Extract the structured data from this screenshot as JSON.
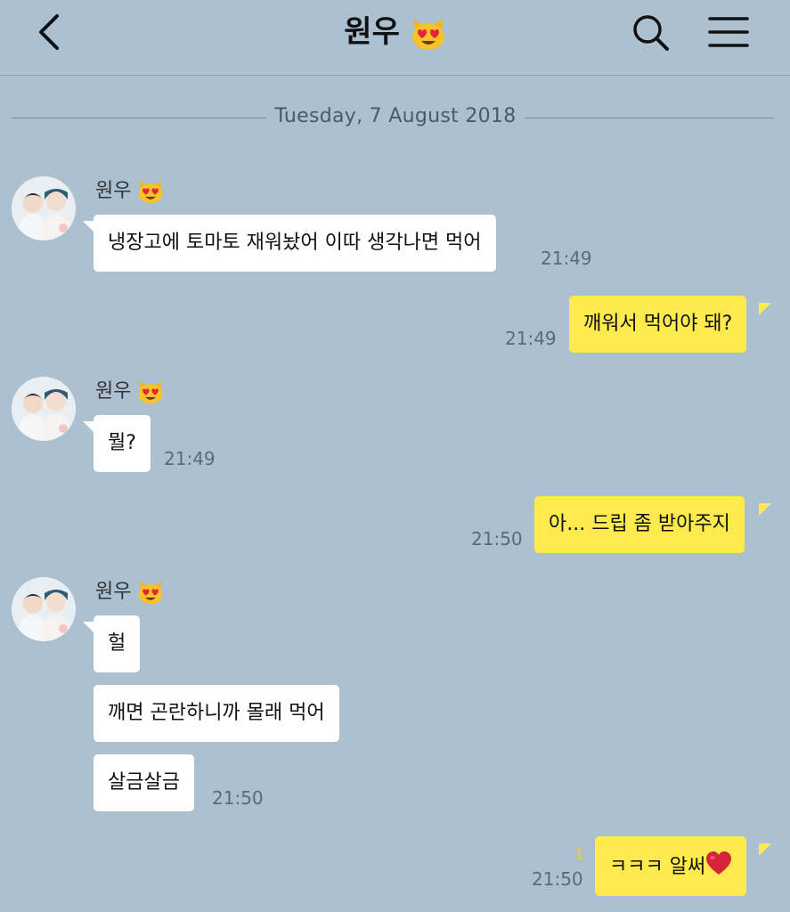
{
  "header": {
    "title": "원우",
    "title_emoji": "smiling-cat-heart-eyes-emoji",
    "back_icon": "chevron-left-icon",
    "search_icon": "search-icon",
    "menu_icon": "hamburger-menu-icon"
  },
  "date_divider": "Tuesday, 7 August 2018",
  "colors": {
    "background": "#abc0d1",
    "incoming_bubble": "#ffffff",
    "outgoing_bubble": "#fdeb4e",
    "unread_count": "#f2d600"
  },
  "messages": [
    {
      "sender": "원우",
      "text": "냉장고에 토마토 재워놨어 이따 생각나면 먹어",
      "time": "21:49"
    },
    {
      "text": "깨워서 먹어야 돼?",
      "time": "21:49"
    },
    {
      "sender": "원우",
      "text": "뭘?",
      "time": "21:49"
    },
    {
      "text": "아... 드립 좀 받아주지",
      "time": "21:50"
    },
    {
      "sender": "원우",
      "text": "헐"
    },
    {
      "text": "깨면 곤란하니까 몰래 먹어"
    },
    {
      "text": "살금살금",
      "time": "21:50"
    },
    {
      "text": "ㅋㅋㅋ 알써",
      "time": "21:50",
      "unread": "1"
    }
  ]
}
